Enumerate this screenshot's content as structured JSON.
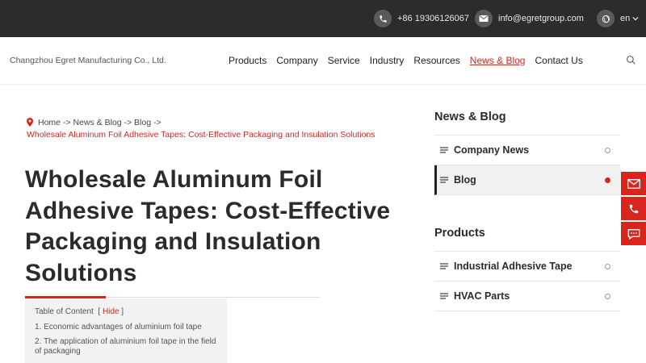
{
  "topbar": {
    "phone": "+86 19306126067",
    "email": "info@egretgroup.com",
    "language": "en"
  },
  "header": {
    "brand": "Changzhou Egret Manufacturing Co., Ltd.",
    "nav": [
      "Products",
      "Company",
      "Service",
      "Industry",
      "Resources",
      "News & Blog",
      "Contact Us"
    ]
  },
  "breadcrumb": {
    "line1": "Home -> News & Blog -> Blog ->",
    "current": "Wholesale Aluminum Foil Adhesive Tapes: Cost-Effective Packaging and Insulation Solutions"
  },
  "article": {
    "title": "Wholesale Aluminum Foil Adhesive Tapes: Cost-Effective Packaging and Insulation Solutions"
  },
  "toc": {
    "heading": "Table of Content",
    "toggle": "Hide",
    "items": [
      "1. Economic advantages of aluminium foil tape",
      "2. The application of aluminium foil tape in the field of packaging"
    ]
  },
  "sidebar": {
    "news_heading": "News & Blog",
    "news_items": [
      "Company News",
      "Blog"
    ],
    "products_heading": "Products",
    "product_items": [
      "Industrial Adhesive Tape",
      "HVAC Parts"
    ]
  },
  "colors": {
    "accent": "#d9251c",
    "topbar": "#2c2c2c"
  }
}
